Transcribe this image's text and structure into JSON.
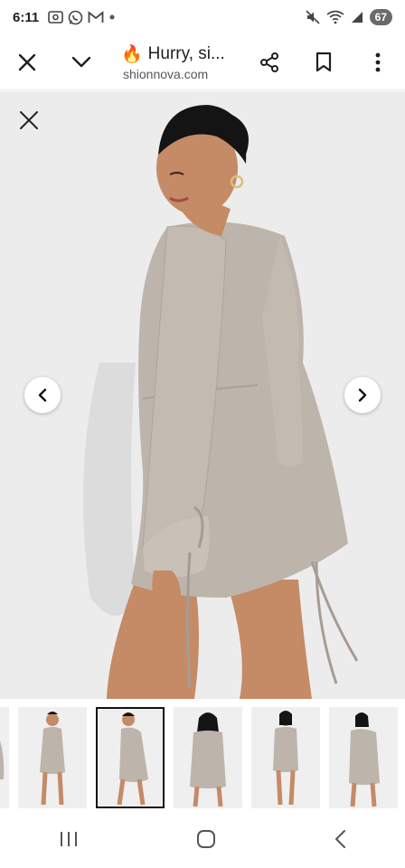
{
  "status_bar": {
    "time": "6:11",
    "battery": "67",
    "notification_icons": [
      "screenshot-icon",
      "whatsapp-icon",
      "gmail-icon",
      "dot-icon"
    ],
    "system_icons": [
      "mute-icon",
      "wifi-6e-icon",
      "signal-icon"
    ]
  },
  "toolbar": {
    "title": "Hurry, si...",
    "title_emoji": "🔥",
    "url": "shionnova.com"
  },
  "viewer": {
    "dress_color": "#bdb4ab",
    "background": "#ededed"
  },
  "thumbnails": {
    "count": 6,
    "selected_index": 2
  },
  "colors": {
    "accent": "#1f1f1f",
    "battery_bg": "#6a6a6a"
  }
}
